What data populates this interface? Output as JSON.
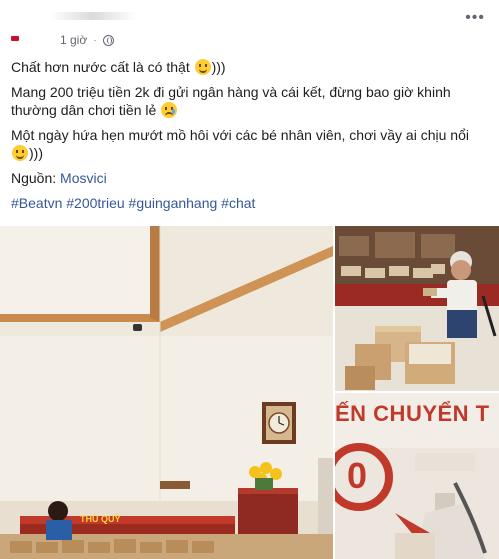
{
  "post": {
    "time": "1 giờ",
    "separator": "·",
    "paragraphs": [
      {
        "text": "Chất hơn nước cất là có thật ",
        "suffix": ")))"
      },
      {
        "text": "Mang 200 triệu tiền 2k đi gửi ngân hàng và cái kết, đừng bao giờ khinh thường dân chơi tiền lẻ "
      },
      {
        "text": "Một ngày hứa hẹn mướt mồ hôi với các bé nhân viên, chơi vầy ai chịu nổi ",
        "suffix": ")))"
      }
    ],
    "source_label": "Nguồn: ",
    "source_link": "Mosvici",
    "hashtags": "#Beatvn #200trieu #guinganhang #chat"
  },
  "photos": {
    "main": {
      "counter_sign": "THỦ QUỸ"
    },
    "bottom_right": {
      "sign": "ẾN CHUYỂN T",
      "number": "0"
    }
  },
  "icons": {
    "more": "more-horizontal-icon",
    "audience": "globe-icon",
    "emoji_smile": "smile-emoji-icon",
    "emoji_sad": "sad-emoji-icon"
  },
  "colors": {
    "link": "#365899",
    "meta": "#616770",
    "text": "#1c1e21"
  }
}
